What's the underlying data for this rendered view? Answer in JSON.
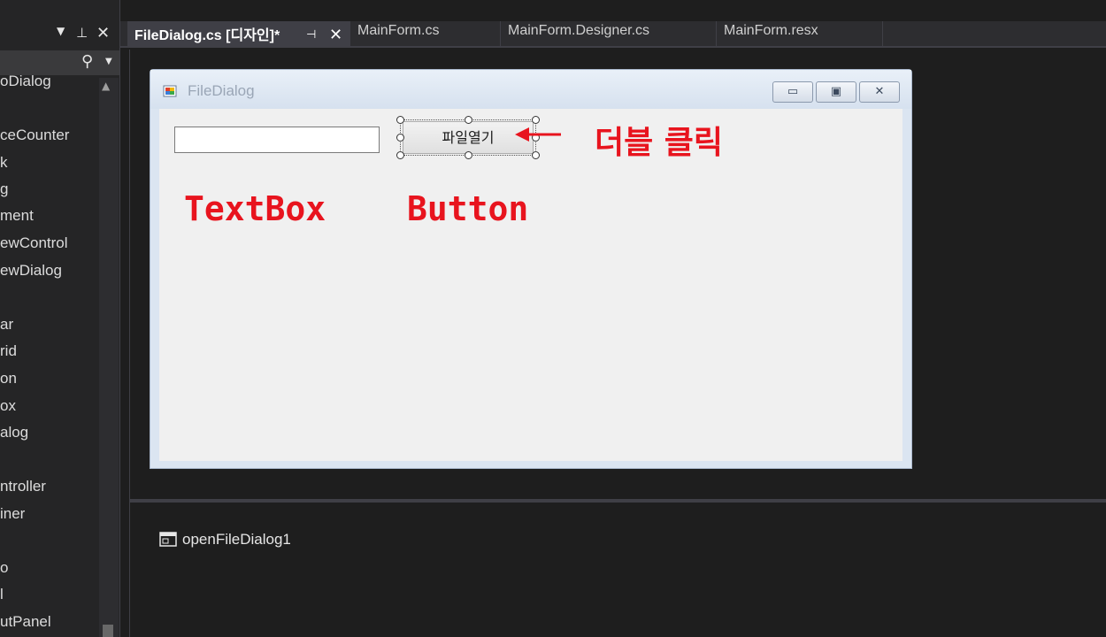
{
  "toolbox": {
    "control_icons": {
      "dropdown": "chevron-down-icon",
      "pin": "pin-icon",
      "close": "close-icon"
    },
    "search_icon": "search-icon",
    "items": [
      "oDialog",
      "ceCounter",
      "k",
      "g",
      "ment",
      "ewControl",
      "ewDialog",
      "ar",
      "rid",
      "on",
      "ox",
      "alog",
      "ntroller",
      "iner",
      "o",
      "l",
      "utPanel"
    ]
  },
  "tabs": [
    {
      "label": "FileDialog.cs [디자인]*",
      "active": true
    },
    {
      "label": "MainForm.cs",
      "active": false
    },
    {
      "label": "MainForm.Designer.cs",
      "active": false
    },
    {
      "label": "MainForm.resx",
      "active": false
    }
  ],
  "form": {
    "title": "FileDialog",
    "caption_buttons": {
      "minimize": "minimize-icon",
      "maximize": "maximize-icon",
      "close": "close-icon"
    },
    "textbox_value": "",
    "button_label": "파일열기"
  },
  "annotations": {
    "double_click": "더블 클릭",
    "textbox": "TextBox",
    "button": "Button",
    "color": "#e8141e"
  },
  "tray": {
    "component_label": "openFileDialog1"
  }
}
